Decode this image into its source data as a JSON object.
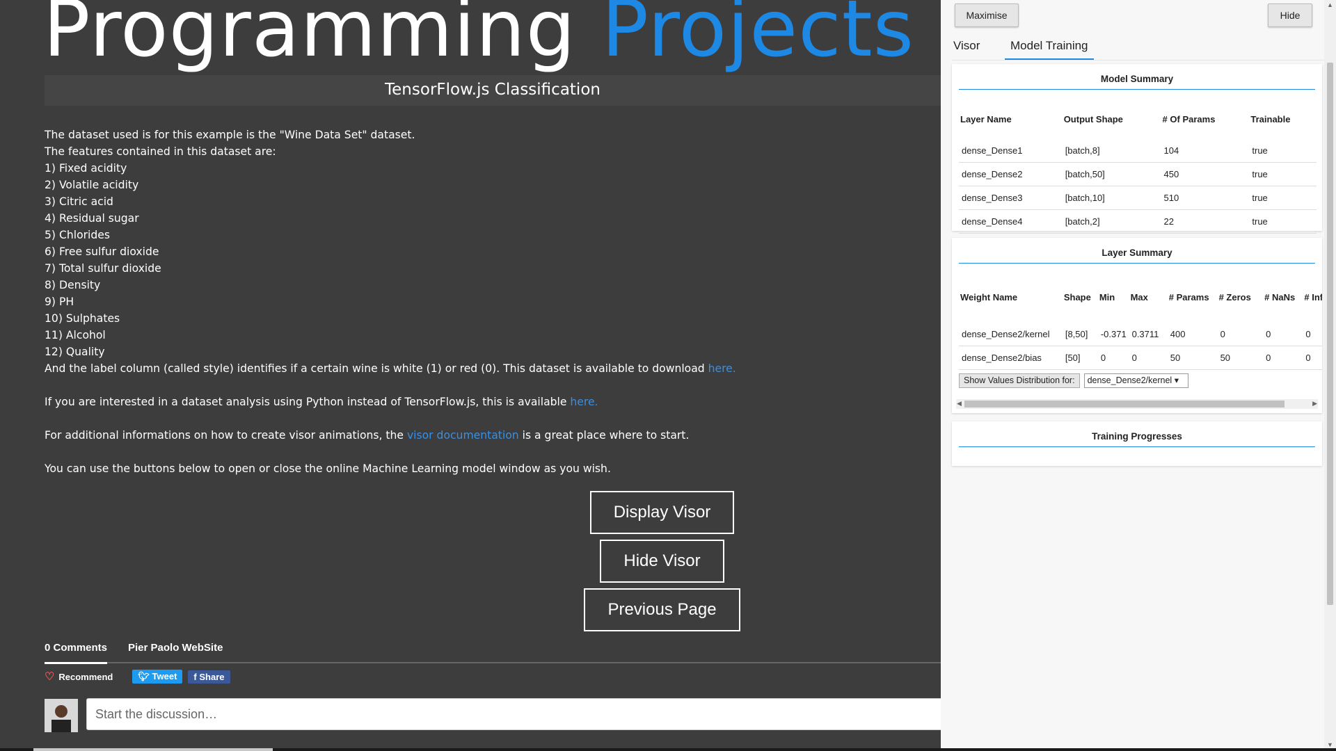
{
  "header": {
    "title_main": "Programming",
    "title_accent": "Projects",
    "subtitle": "TensorFlow.js Classification"
  },
  "content": {
    "intro1": "The dataset used is for this example is the \"Wine Data Set\" dataset.",
    "intro2": "The features contained in this dataset are:",
    "features": [
      "1) Fixed acidity",
      "2) Volatile acidity",
      "3) Citric acid",
      "4) Residual sugar",
      "5) Chlorides",
      "6) Free sulfur dioxide",
      "7) Total sulfur dioxide",
      "8) Density",
      "9) PH",
      "10) Sulphates",
      "11) Alcohol",
      "12) Quality"
    ],
    "label_text": "And the label column (called style) identifies if a certain wine is white (1) or red (0). This dataset is available to download ",
    "label_link": "here.",
    "python_text": "If you are interested in a dataset analysis using Python instead of TensorFlow.js, this is available ",
    "python_link": "here.",
    "visor_text_before": "For additional informations on how to create visor animations, the ",
    "visor_link": "visor documentation",
    "visor_text_after": " is a great place where to start.",
    "buttons_text": "You can use the buttons below to open or close the online Machine Learning model window as you wish."
  },
  "buttons": {
    "display": "Display Visor",
    "hide": "Hide Visor",
    "previous": "Previous Page"
  },
  "comments": {
    "count_tab": "0 Comments",
    "site_tab": "Pier Paolo WebSite",
    "recommend": "Recommend",
    "tweet": "Tweet",
    "share": "Share",
    "placeholder": "Start the discussion…"
  },
  "visor": {
    "maximise": "Maximise",
    "hide": "Hide",
    "tabs": [
      "Visor",
      "Model Training"
    ],
    "model_summary": {
      "title": "Model Summary",
      "headers": [
        "Layer Name",
        "Output Shape",
        "# Of Params",
        "Trainable"
      ],
      "rows": [
        [
          "dense_Dense1",
          "[batch,8]",
          "104",
          "true"
        ],
        [
          "dense_Dense2",
          "[batch,50]",
          "450",
          "true"
        ],
        [
          "dense_Dense3",
          "[batch,10]",
          "510",
          "true"
        ],
        [
          "dense_Dense4",
          "[batch,2]",
          "22",
          "true"
        ]
      ]
    },
    "layer_summary": {
      "title": "Layer Summary",
      "headers": [
        "Weight Name",
        "Shape",
        "Min",
        "Max",
        "# Params",
        "# Zeros",
        "# NaNs",
        "# Infi"
      ],
      "rows": [
        [
          "dense_Dense2/kernel",
          "[8,50]",
          "-0.371",
          "0.3711",
          "400",
          "0",
          "0",
          "0"
        ],
        [
          "dense_Dense2/bias",
          "[50]",
          "0",
          "0",
          "50",
          "50",
          "0",
          "0"
        ]
      ],
      "dist_button": "Show Values Distribution for:",
      "dist_selected": "dense_Dense2/kernel"
    },
    "training": {
      "title": "Training Progresses"
    }
  },
  "colors": {
    "accent": "#1e88e5",
    "page_bg": "#3d3d3d",
    "link": "#3b8fe0"
  }
}
